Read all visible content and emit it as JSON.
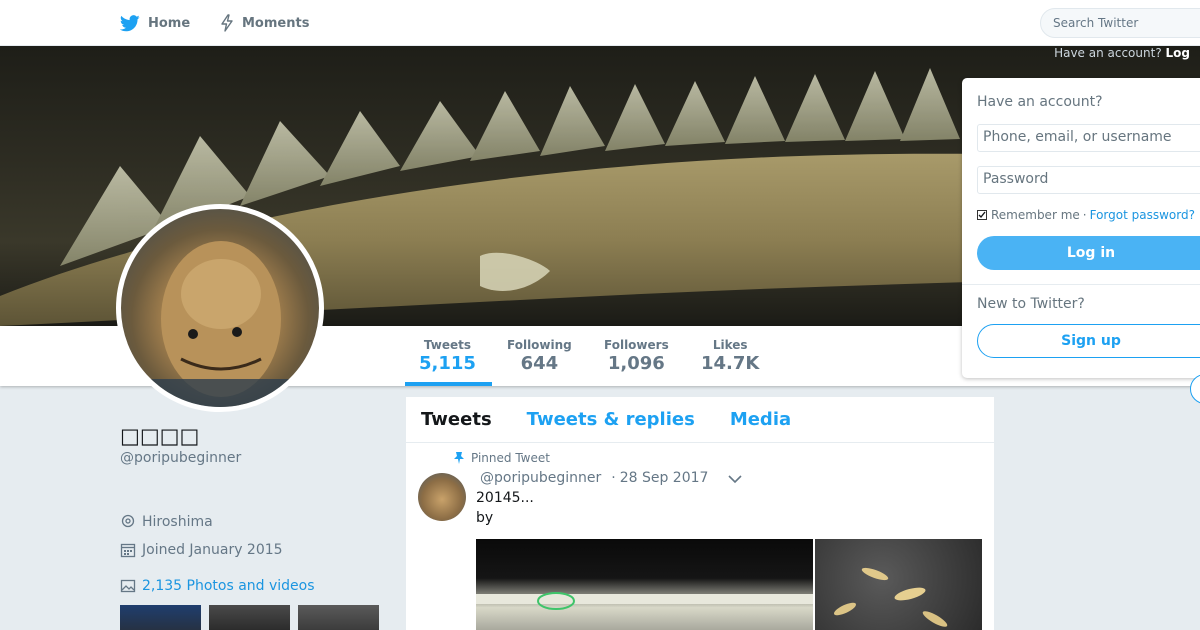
{
  "nav": {
    "home_label": "Home",
    "moments_label": "Moments",
    "search_placeholder": "Search Twitter"
  },
  "top_login_hint": {
    "question": "Have an account?",
    "link": "Log"
  },
  "profile": {
    "name": "□□□□",
    "handle": "@poripubeginner",
    "location": "Hiroshima",
    "joined": "Joined January 2015",
    "photos_videos": "2,135 Photos and videos"
  },
  "stats": [
    {
      "label": "Tweets",
      "value": "5,115",
      "active": true
    },
    {
      "label": "Following",
      "value": "644"
    },
    {
      "label": "Followers",
      "value": "1,096"
    },
    {
      "label": "Likes",
      "value": "14.7K"
    }
  ],
  "timeline": {
    "tabs": [
      "Tweets",
      "Tweets & replies",
      "Media"
    ],
    "pinned_label": "Pinned Tweet",
    "tweet": {
      "handle": "@poripubeginner",
      "date": "28 Sep 2017",
      "text_line1": "20145...",
      "text_line2": "by"
    }
  },
  "login": {
    "title": "Have an account?",
    "username_placeholder": "Phone, email, or username",
    "password_placeholder": "Password",
    "remember_label": "Remember me",
    "separator": "·",
    "forgot_label": "Forgot password?",
    "login_button": "Log in",
    "new_to": "New to Twitter?",
    "signup_button": "Sign up"
  },
  "colors": {
    "accent": "#1da1f2",
    "login_button": "#4ab3f4",
    "background": "#e6ecf0"
  }
}
